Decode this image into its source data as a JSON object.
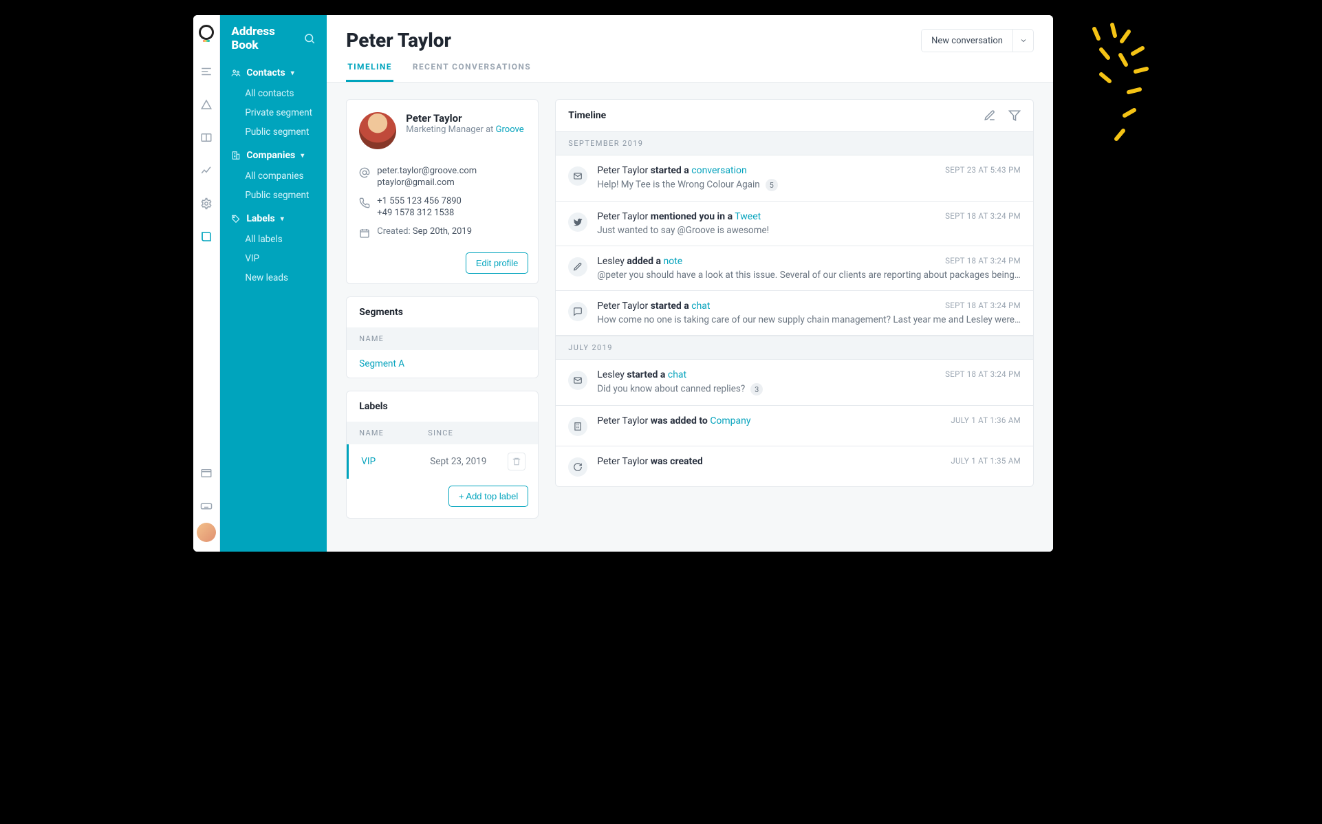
{
  "sidebar": {
    "title": "Address Book",
    "groups": [
      {
        "label": "Contacts",
        "items": [
          "All contacts",
          "Private segment",
          "Public segment"
        ]
      },
      {
        "label": "Companies",
        "items": [
          "All companies",
          "Public segment"
        ]
      },
      {
        "label": "Labels",
        "items": [
          "All labels",
          "VIP",
          "New leads"
        ]
      }
    ]
  },
  "page": {
    "title": "Peter Taylor",
    "new_conversation_label": "New conversation",
    "tabs": [
      "TIMELINE",
      "RECENT CONVERSATIONS"
    ],
    "active_tab": 0
  },
  "profile": {
    "name": "Peter Taylor",
    "role_prefix": "Marketing Manager at ",
    "role_company": "Groove",
    "emails": [
      "peter.taylor@groove.com",
      "ptaylor@gmail.com"
    ],
    "phones": [
      "+1 555 123 456 7890",
      "+49 1578 312 1538"
    ],
    "created_label": "Created:",
    "created_value": "Sep 20th, 2019",
    "edit_label": "Edit profile"
  },
  "segments": {
    "title": "Segments",
    "col_name": "NAME",
    "rows": [
      {
        "name": "Segment A"
      }
    ]
  },
  "labels": {
    "title": "Labels",
    "col_name": "NAME",
    "col_since": "SINCE",
    "rows": [
      {
        "name": "VIP",
        "since": "Sept 23, 2019"
      }
    ],
    "add_label": "+ Add top label"
  },
  "timeline": {
    "title": "Timeline",
    "groups": [
      {
        "label": "SEPTEMBER 2019",
        "items": [
          {
            "icon": "mail",
            "actor": "Peter Taylor",
            "verb": "started a",
            "object": "conversation",
            "object_link": true,
            "sub": "Help! My Tee is the Wrong Colour Again",
            "badge": "5",
            "time": "SEPT 23 AT 5:43 PM"
          },
          {
            "icon": "twitter",
            "actor": "Peter Taylor",
            "verb": "mentioned you in a",
            "object": "Tweet",
            "object_link": true,
            "sub": "Just wanted to say @Groove is awesome!",
            "time": "SEPT 18 AT 3:24 PM"
          },
          {
            "icon": "pencil",
            "actor": "Lesley",
            "verb": "added a",
            "object": "note",
            "object_link": true,
            "sub": "@peter you should have a look at this issue. Several of our clients are reporting about packages being…",
            "time": "SEPT 18 AT 3:24 PM"
          },
          {
            "icon": "chat",
            "actor": "Peter Taylor",
            "verb": "started a",
            "object": "chat",
            "object_link": true,
            "sub": "How come no one is taking care of our new supply chain management? Last year me and Lesley were…",
            "time": "SEPT 18 AT 3:24 PM"
          }
        ]
      },
      {
        "label": "JULY 2019",
        "items": [
          {
            "icon": "mail",
            "actor": "Lesley",
            "verb": "started a",
            "object": "chat",
            "object_link": true,
            "sub": "Did you know about canned replies?",
            "badge": "3",
            "time": "SEPT 18 AT 3:24 PM"
          },
          {
            "icon": "building",
            "actor": "Peter Taylor",
            "verb": "was added to",
            "object": "Company",
            "object_link": true,
            "time": "JULY 1 AT 1:36 AM"
          },
          {
            "icon": "refresh",
            "actor": "Peter Taylor",
            "verb": "was created",
            "object": "",
            "object_link": false,
            "time": "JULY 1 AT 1:35 AM"
          }
        ]
      }
    ]
  }
}
